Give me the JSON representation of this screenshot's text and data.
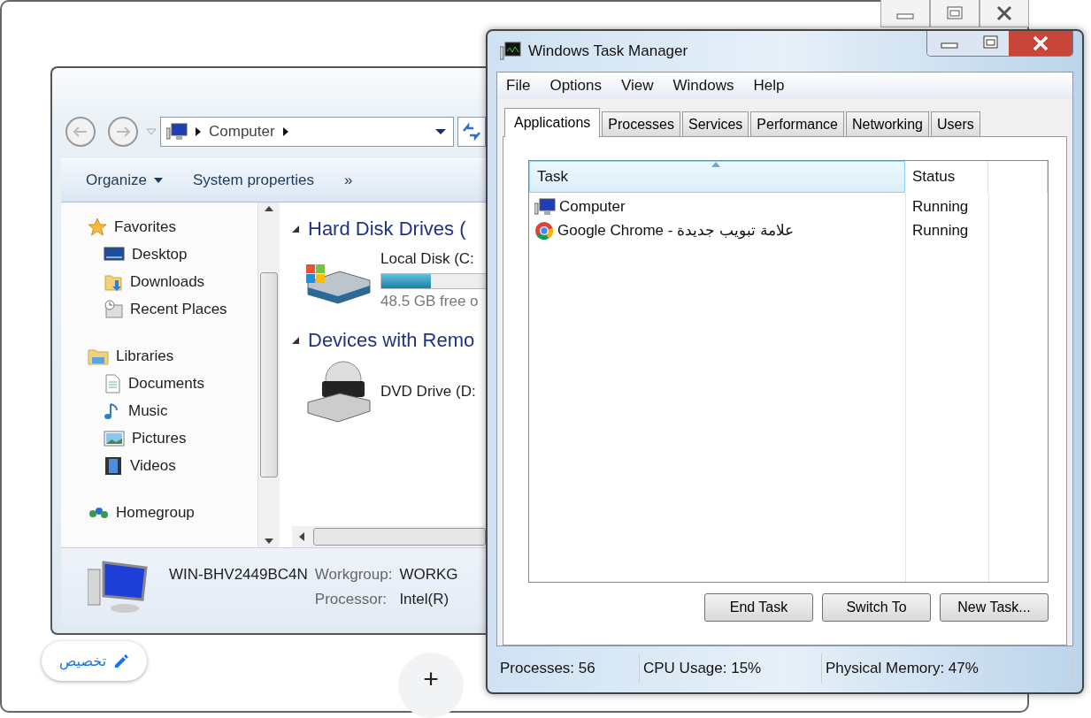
{
  "browser": {
    "customize_button": "تخصيص",
    "new_tab_button": "+"
  },
  "explorer": {
    "address": [
      "Computer"
    ],
    "toolbar": [
      {
        "label": "Organize",
        "kind": "menu"
      },
      {
        "label": "System properties",
        "kind": "plain"
      },
      {
        "label": "»",
        "kind": "more"
      }
    ],
    "nav": [
      {
        "label": "Favorites",
        "kind": "star",
        "children": [
          {
            "label": "Desktop",
            "kind": "desktop"
          },
          {
            "label": "Downloads",
            "kind": "downloads"
          },
          {
            "label": "Recent Places",
            "kind": "recent"
          }
        ]
      },
      {
        "label": "Libraries",
        "kind": "library",
        "children": [
          {
            "label": "Documents",
            "kind": "document"
          },
          {
            "label": "Music",
            "kind": "music"
          },
          {
            "label": "Pictures",
            "kind": "pictures"
          },
          {
            "label": "Videos",
            "kind": "videos"
          }
        ]
      },
      {
        "label": "Homegroup",
        "kind": "homegroup"
      }
    ],
    "sections": [
      {
        "title": "Hard Disk Drives (",
        "items": [
          {
            "name": "Local Disk (C:",
            "kind": "disk",
            "level": 0.47,
            "free": "48.5 GB free o"
          }
        ]
      },
      {
        "title": "Devices with Remo",
        "items": [
          {
            "name": "DVD Drive (D:",
            "kind": "dvd"
          }
        ]
      }
    ],
    "details": {
      "computer_name": "WIN-BHV2449BC4N",
      "fields": [
        {
          "label": "Workgroup:",
          "value": "WORKG"
        },
        {
          "label": "Processor:",
          "value": "Intel(R)"
        }
      ]
    }
  },
  "task_manager": {
    "title": "Windows Task Manager",
    "menu": [
      "File",
      "Options",
      "View",
      "Windows",
      "Help"
    ],
    "tabs": [
      {
        "label": "Applications",
        "selected": true
      },
      {
        "label": "Processes",
        "selected": false
      },
      {
        "label": "Services",
        "selected": false
      },
      {
        "label": "Performance",
        "selected": false
      },
      {
        "label": "Networking",
        "selected": false
      },
      {
        "label": "Users",
        "selected": false
      }
    ],
    "columns": [
      "Task",
      "Status"
    ],
    "rows": [
      {
        "task": "Computer",
        "status": "Running",
        "kind": "computer"
      },
      {
        "task": "Google Chrome - علامة تبويب جديدة",
        "status": "Running",
        "kind": "chrome"
      }
    ],
    "buttons": [
      "End Task",
      "Switch To",
      "New Task..."
    ],
    "status_bar": [
      "Processes: 56",
      "CPU Usage: 15%",
      "Physical Memory: 47%"
    ]
  }
}
